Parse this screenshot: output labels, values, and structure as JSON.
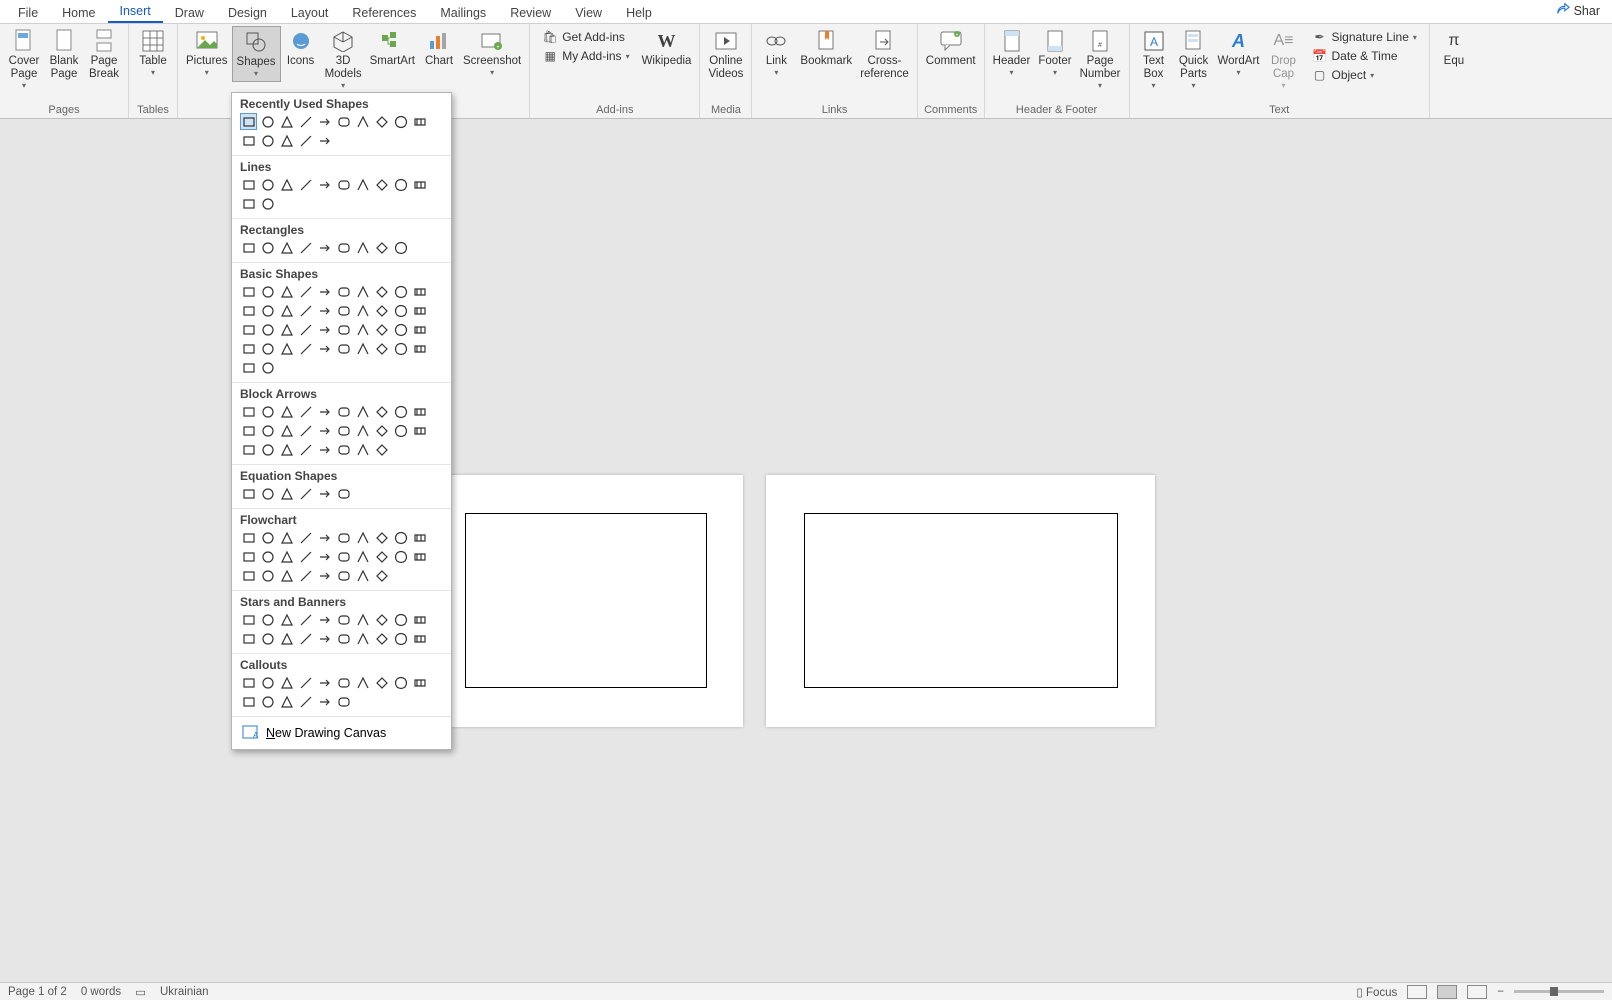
{
  "tabs": [
    "File",
    "Home",
    "Insert",
    "Draw",
    "Design",
    "Layout",
    "References",
    "Mailings",
    "Review",
    "View",
    "Help"
  ],
  "active_tab": "Insert",
  "share": "Shar",
  "ribbon": {
    "pages": {
      "label": "Pages",
      "cover": "Cover\nPage",
      "blank": "Blank\nPage",
      "break": "Page\nBreak"
    },
    "tables": {
      "label": "Tables",
      "table": "Table"
    },
    "illus": {
      "pictures": "Pictures",
      "shapes": "Shapes",
      "icons": "Icons",
      "models": "3D\nModels",
      "smartart": "SmartArt",
      "chart": "Chart",
      "screenshot": "Screenshot"
    },
    "addins": {
      "label": "Add-ins",
      "get": "Get Add-ins",
      "my": "My Add-ins",
      "wiki": "Wikipedia"
    },
    "media": {
      "label": "Media",
      "videos": "Online\nVideos"
    },
    "links": {
      "label": "Links",
      "link": "Link",
      "bookmark": "Bookmark",
      "cross": "Cross-\nreference"
    },
    "comments": {
      "label": "Comments",
      "comment": "Comment"
    },
    "hf": {
      "label": "Header & Footer",
      "header": "Header",
      "footer": "Footer",
      "page": "Page\nNumber"
    },
    "text": {
      "label": "Text",
      "textbox": "Text\nBox",
      "quick": "Quick\nParts",
      "wordart": "WordArt",
      "drop": "Drop\nCap",
      "sig": "Signature Line",
      "date": "Date & Time",
      "obj": "Object"
    },
    "eq": "Equ"
  },
  "shapes_panel": {
    "recent": "Recently Used Shapes",
    "lines": "Lines",
    "rects": "Rectangles",
    "basic": "Basic Shapes",
    "block": "Block Arrows",
    "eq": "Equation Shapes",
    "flow": "Flowchart",
    "stars": "Stars and Banners",
    "call": "Callouts",
    "canvas_pre": "N",
    "canvas_rest": "ew Drawing Canvas",
    "counts": {
      "recent": 15,
      "lines": 12,
      "rects": 9,
      "basic": 42,
      "block": 28,
      "eq": 6,
      "flow": 28,
      "stars": 20,
      "call": 16
    }
  },
  "status": {
    "page": "Page 1 of 2",
    "words": "0 words",
    "lang": "Ukrainian",
    "focus": "Focus"
  }
}
